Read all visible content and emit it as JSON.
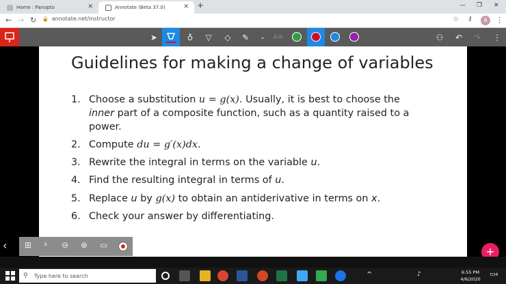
{
  "browser": {
    "tabs": [
      {
        "title": "Home : Panopto",
        "active": false
      },
      {
        "title": "Annotate (Beta 37.0)",
        "active": true
      }
    ],
    "new_tab_label": "+",
    "url": "annotate.net/instructor",
    "avatar_letter": "A"
  },
  "annotate_toolbar": {
    "colors": [
      "#2ea043",
      "#c8102e",
      "#1e88e5",
      "#8e24aa"
    ],
    "selected_color": "#c8102e"
  },
  "slide": {
    "title": "Guidelines for making a change of variables",
    "items": [
      {
        "num": "1.",
        "lines": [
          "Choose a substitution ",
          "u = g(x)",
          ". Usually, it is best to choose the"
        ],
        "line2": [
          "inner",
          " part of a composite function, such as a quantity raised to a"
        ],
        "line3": "power."
      },
      {
        "num": "2.",
        "pre": "Compute ",
        "math": "du = g′(x)dx",
        "post": "."
      },
      {
        "num": "3.",
        "pre": "Rewrite the integral in terms on the variable ",
        "var": "u",
        "post": "."
      },
      {
        "num": "4.",
        "pre": "Find the resulting integral in terms of ",
        "var": "u",
        "post": "."
      },
      {
        "num": "5.",
        "pre": "Replace ",
        "var": "u",
        "mid": " by ",
        "math": "g(x)",
        "post2": " to obtain an antiderivative in terms on ",
        "var2": "x",
        "post": "."
      },
      {
        "num": "6.",
        "text": "Check your answer by differentiating."
      }
    ]
  },
  "taskbar": {
    "search_placeholder": "Type here to search",
    "time": "6:55 PM",
    "date": "4/6/2020",
    "notification_count": "4"
  }
}
